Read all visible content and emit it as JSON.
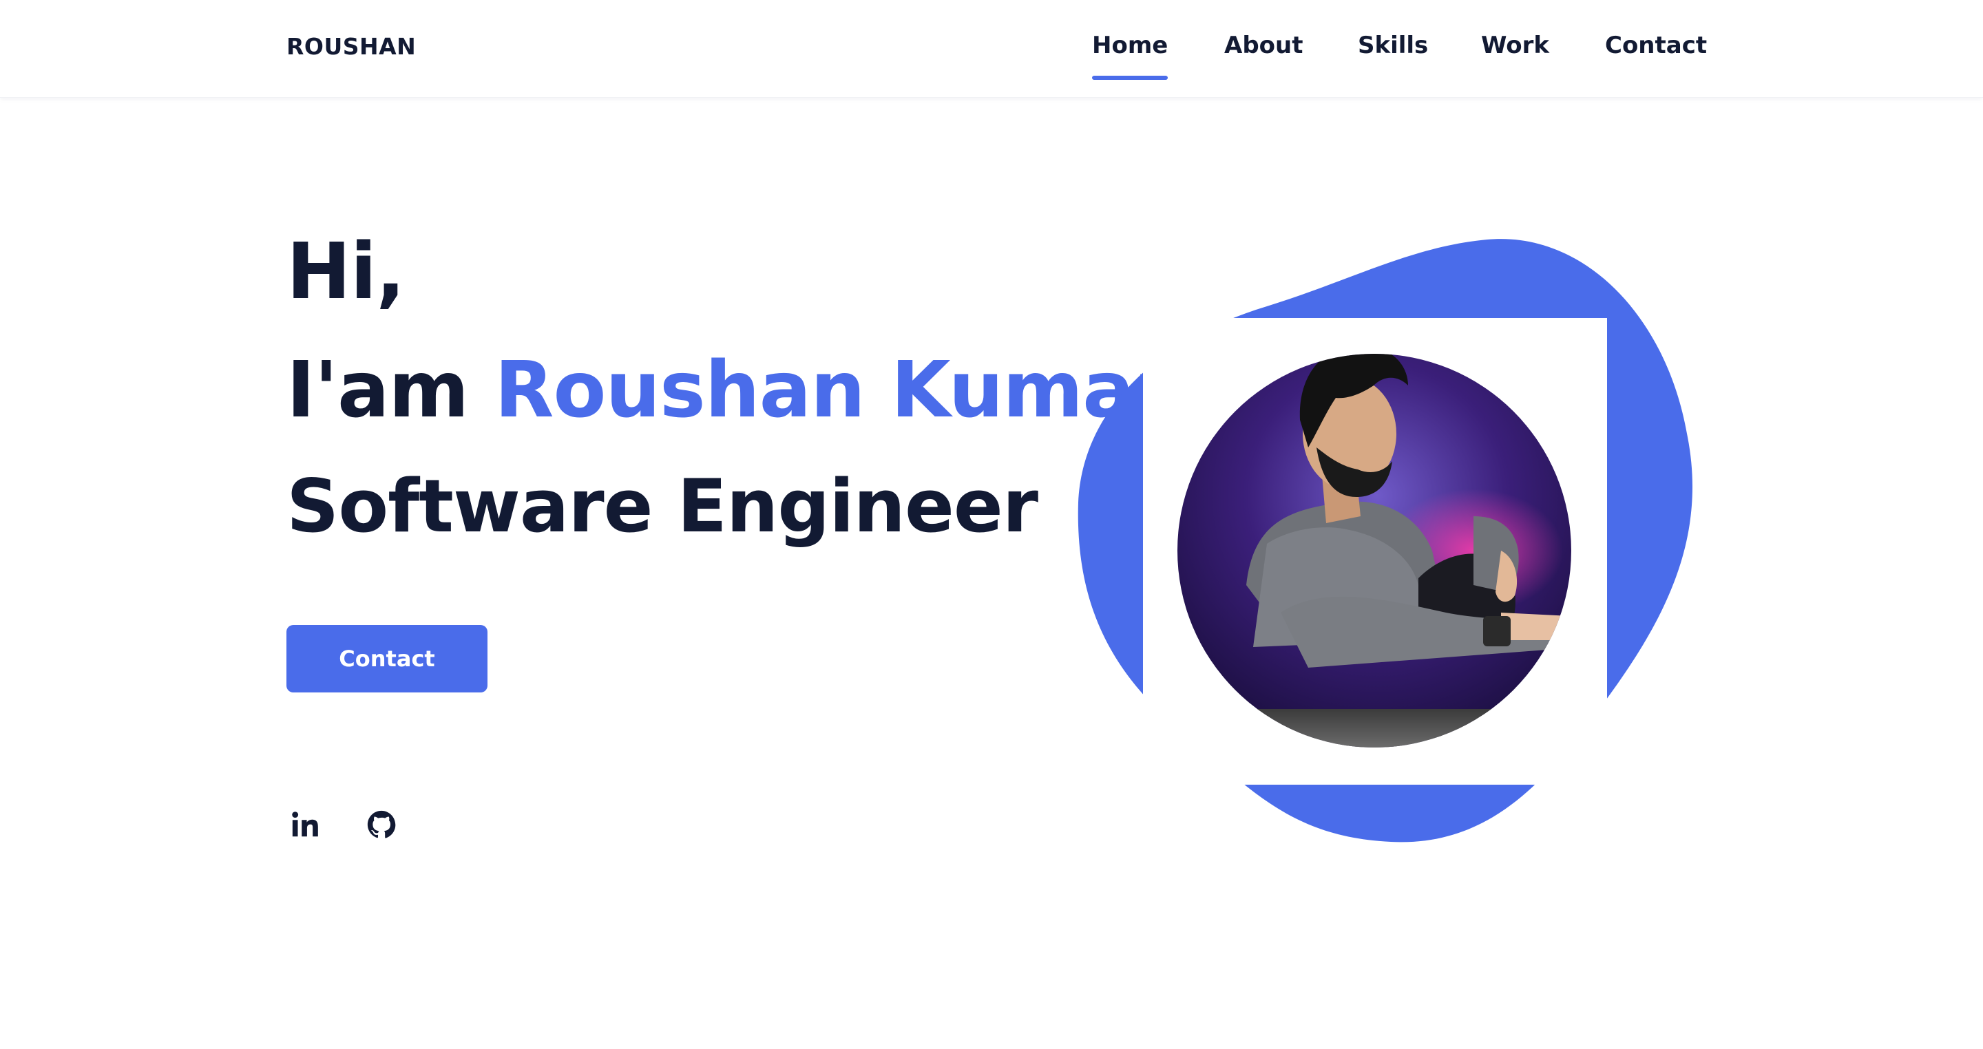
{
  "header": {
    "logo": "ROUSHAN",
    "nav": [
      {
        "label": "Home",
        "active": true
      },
      {
        "label": "About",
        "active": false
      },
      {
        "label": "Skills",
        "active": false
      },
      {
        "label": "Work",
        "active": false
      },
      {
        "label": "Contact",
        "active": false
      }
    ]
  },
  "hero": {
    "greeting": "Hi,",
    "intro_prefix": "I'am",
    "name": "Roushan Kumar",
    "role": "Software Engineer",
    "contact_button": "Contact"
  },
  "social": [
    {
      "icon": "linkedin-icon"
    },
    {
      "icon": "github-icon"
    }
  ],
  "colors": {
    "accent": "#4a6cea",
    "text": "#121a33",
    "background": "#ffffff"
  }
}
